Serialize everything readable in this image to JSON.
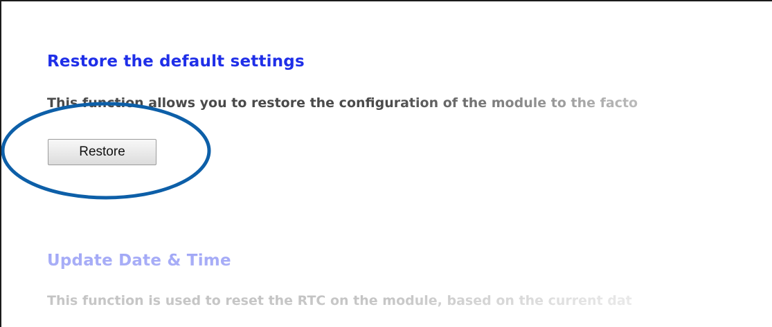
{
  "restore_section": {
    "title": "Restore the default settings",
    "description": "This function allows you to restore the configuration of the module to the facto",
    "button_label": "Restore"
  },
  "datetime_section": {
    "title": "Update Date & Time",
    "description": "This function is used to reset the RTC on the module, based on the current dat"
  },
  "colors": {
    "title_blue": "#1f2fe8",
    "body_text": "#4a4a4a",
    "highlight_ring": "#0d5fa8"
  }
}
